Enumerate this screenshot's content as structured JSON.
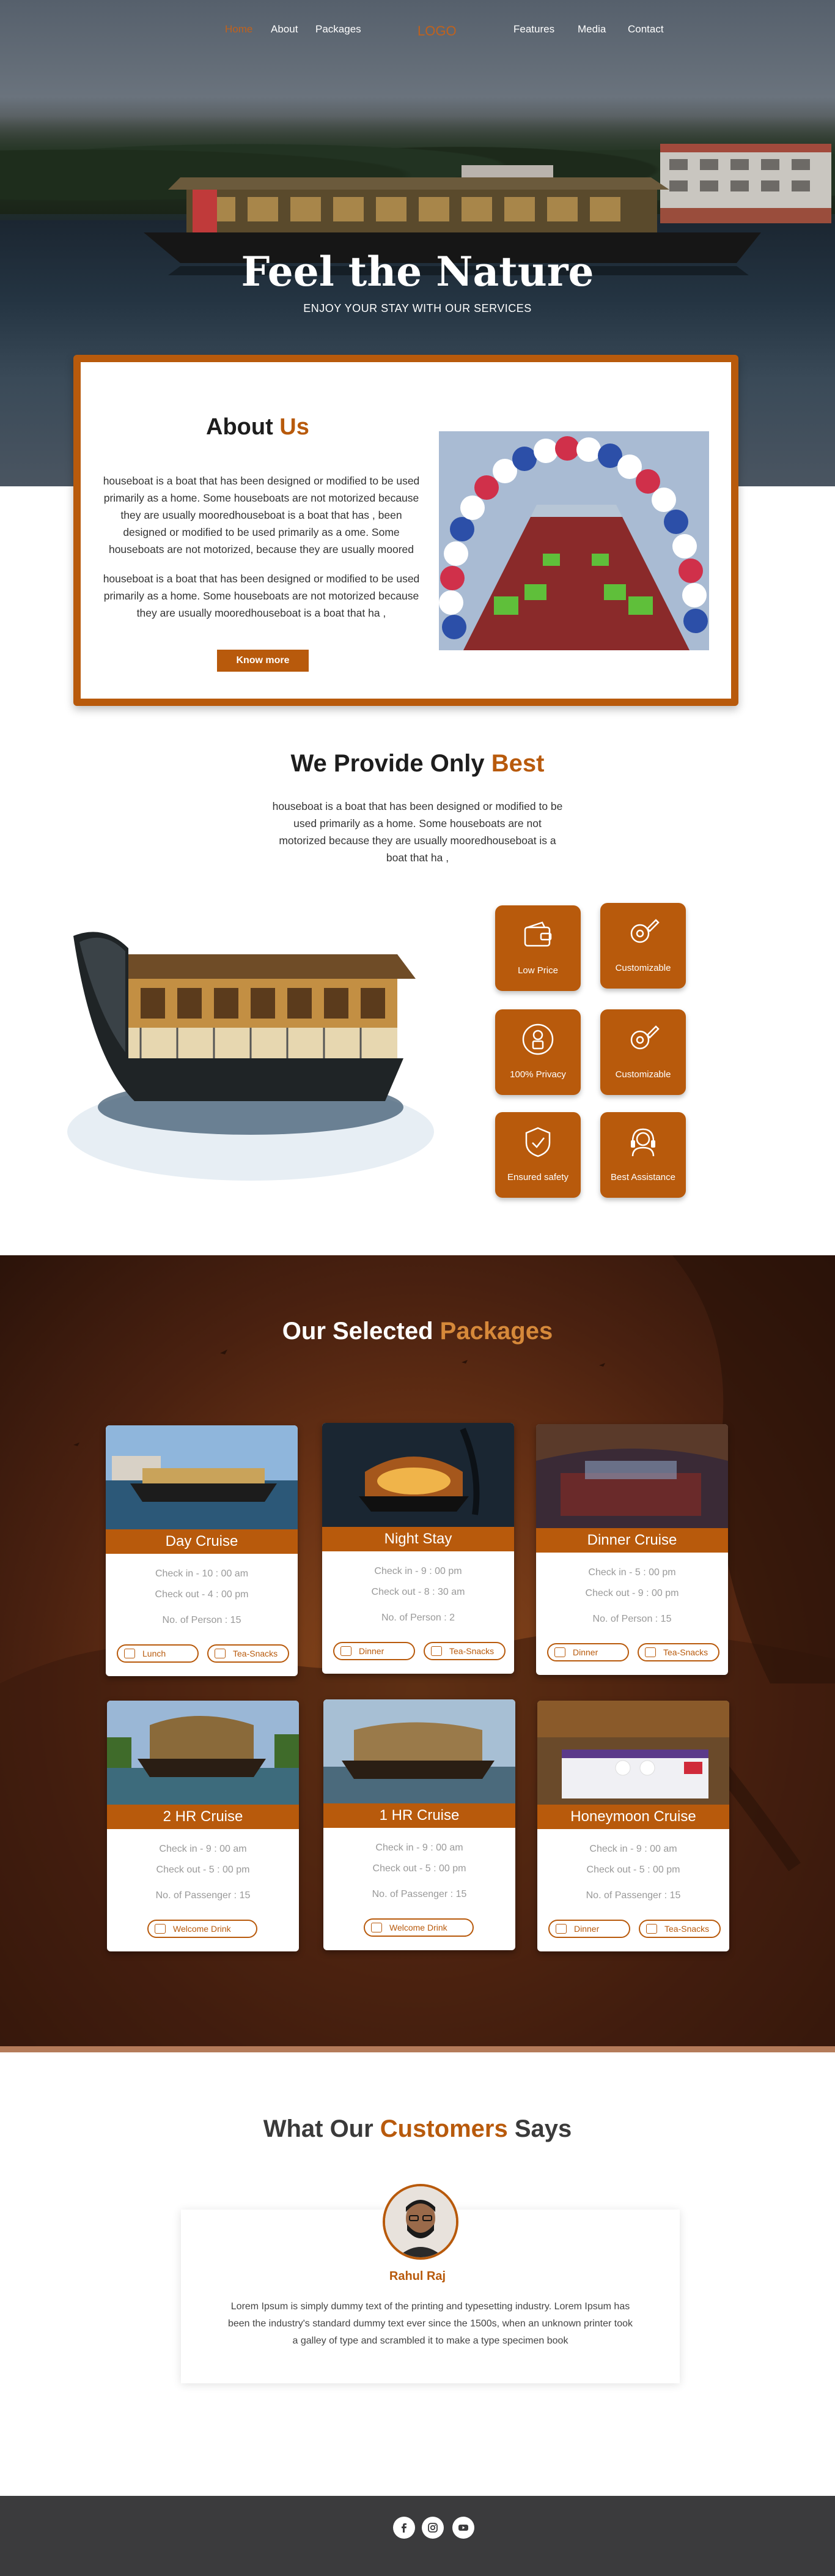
{
  "nav": {
    "items": [
      "Home",
      "About",
      "Packages",
      "Features",
      "Media",
      "Contact"
    ],
    "logo": "LOGO",
    "active": "Home"
  },
  "hero": {
    "title": "Feel the Nature",
    "subtitle": "ENJOY YOUR STAY WITH OUR SERVICES"
  },
  "about": {
    "title_main": "About ",
    "title_accent": "Us",
    "para1": "houseboat is a boat that has been designed or modified to be used primarily as a home. Some houseboats are not motorized because they are usually mooredhouseboat is a boat that has , been designed or modified to be used primarily as a ome. Some houseboats are not motorized, because they are usually moored",
    "para2": "houseboat is a boat that has been designed or modified to be used primarily as a home. Some houseboats are not motorized because they are usually mooredhouseboat is a boat that ha ,",
    "button": "Know more"
  },
  "provide": {
    "title_main": "We Provide Only ",
    "title_accent": "Best",
    "para": "houseboat is a boat that has been designed or modified to be used primarily as a home. Some houseboats are not motorized because they are usually mooredhouseboat is a boat that ha ,",
    "features": [
      {
        "label": "Low Price",
        "icon": "wallet-icon"
      },
      {
        "label": "Customizable",
        "icon": "gear-pencil-icon"
      },
      {
        "label": "100% Privacy",
        "icon": "person-lock-icon"
      },
      {
        "label": "Customizable",
        "icon": "gear-pencil-icon"
      },
      {
        "label": "Ensured safety",
        "icon": "shield-check-icon"
      },
      {
        "label": "Best Assistance",
        "icon": "headset-icon"
      }
    ]
  },
  "packages": {
    "title_main": "Our Selected ",
    "title_accent": "Packages",
    "cards": [
      {
        "name": "Day Cruise",
        "line1": "Check in   -    10 : 00 am",
        "line2": "Check out   -  4 : 00 pm",
        "line3": "No. of Person : 15",
        "pills": [
          "Lunch",
          "Tea-Snacks"
        ]
      },
      {
        "name": "Night Stay",
        "line1": "Check in   -    9 : 00 pm",
        "line2": "Check out  -  8 : 30 am",
        "line3": "No. of Person :  2",
        "pills": [
          "Dinner",
          "Tea-Snacks"
        ]
      },
      {
        "name": "Dinner Cruise",
        "line1": "Check in   -    5 : 00 pm",
        "line2": "Check out  -  9 : 00 pm",
        "line3": "No. of Person : 15",
        "pills": [
          "Dinner",
          "Tea-Snacks"
        ]
      },
      {
        "name": "2 HR Cruise",
        "line1": "Check in   -    9 : 00 am",
        "line2": "Check out  -  5 : 00 pm",
        "line3": "No. of Passenger : 15",
        "pills": [
          "Welcome Drink"
        ]
      },
      {
        "name": "1 HR Cruise",
        "line1": "Check in   -    9 : 00 am",
        "line2": "Check out  -  5 : 00 pm",
        "line3": "No. of Passenger : 15",
        "pills": [
          "Welcome Drink"
        ]
      },
      {
        "name": "Honeymoon Cruise",
        "line1": "Check in   -    9 : 00 am",
        "line2": "Check out  -  5 : 00 pm",
        "line3": "No. of Passenger : 15",
        "pills": [
          "Dinner",
          "Tea-Snacks"
        ]
      }
    ]
  },
  "testimonials": {
    "title_pre": "What Our ",
    "title_accent": "Customers",
    "title_post": " Says",
    "name": "Rahul Raj",
    "text": "Lorem Ipsum is simply dummy text of the printing and typesetting industry. Lorem Ipsum has been the industry's standard dummy text ever since the 1500s, when an unknown printer took a galley of type and scrambled it to make a type specimen book"
  },
  "footer": {
    "socials": [
      "facebook-icon",
      "instagram-icon",
      "youtube-icon"
    ]
  },
  "colors": {
    "accent": "#b85a0c",
    "footer": "#3b3b3d"
  }
}
